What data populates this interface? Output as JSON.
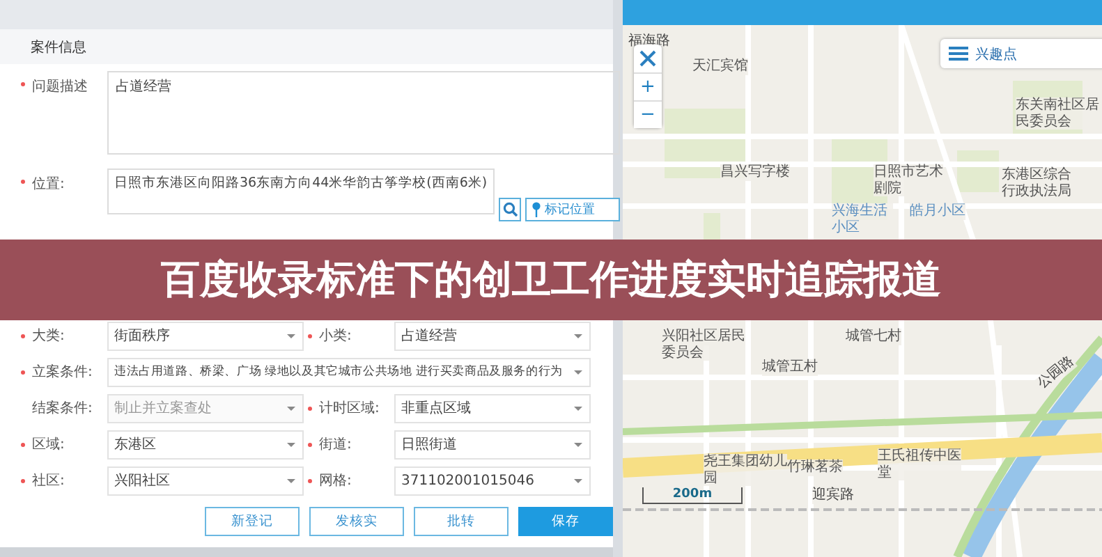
{
  "case_form": {
    "title": "案件信息",
    "description": {
      "label": "问题描述",
      "required": true,
      "value": "占道经营"
    },
    "location": {
      "label": "位置:",
      "required": true,
      "value": "日照市东港区向阳路36东南方向44米华韵古筝学校(西南6米)",
      "mark_button": "标记位置"
    },
    "rows": [
      [
        {
          "label": "大类:",
          "required": true,
          "value": "街面秩序",
          "disabled": false,
          "dropdown": true
        },
        {
          "label": "小类:",
          "required": true,
          "value": "占道经营",
          "disabled": false,
          "dropdown": true
        }
      ],
      [
        {
          "label": "立案条件:",
          "required": true,
          "value": "违法占用道路、桥梁、广场 绿地以及其它城市公共场地 进行买卖商品及服务的行为",
          "disabled": false,
          "dropdown": true
        }
      ],
      [
        {
          "label": "结案条件:",
          "required": false,
          "value": "制止并立案查处",
          "disabled": true,
          "dropdown": true
        },
        {
          "label": "计时区域:",
          "required": true,
          "value": "非重点区域",
          "disabled": false,
          "dropdown": true
        }
      ],
      [
        {
          "label": "区域:",
          "required": true,
          "value": "东港区",
          "disabled": false,
          "dropdown": true
        },
        {
          "label": "街道:",
          "required": true,
          "value": "日照街道",
          "disabled": false,
          "dropdown": true
        }
      ],
      [
        {
          "label": "社区:",
          "required": true,
          "value": "兴阳社区",
          "disabled": false,
          "dropdown": true
        },
        {
          "label": "网格:",
          "required": true,
          "value": "371102001015046",
          "disabled": false,
          "dropdown": true
        }
      ]
    ],
    "buttons": [
      {
        "label": "新登记",
        "primary": false
      },
      {
        "label": "发核实",
        "primary": false
      },
      {
        "label": "批转",
        "primary": false
      },
      {
        "label": "保存",
        "primary": true
      }
    ]
  },
  "map": {
    "zoom_in": "+",
    "zoom_out": "−",
    "poi_button": "兴趣点",
    "scale": "200m",
    "labels": [
      {
        "text": "福海路",
        "kind": "road"
      },
      {
        "text": "天汇宾馆",
        "kind": "place"
      },
      {
        "text": "东关南社区居民委员会",
        "kind": "place"
      },
      {
        "text": "昌兴写字楼",
        "kind": "place"
      },
      {
        "text": "日照市艺术剧院",
        "kind": "place"
      },
      {
        "text": "东港区综合行政执法局",
        "kind": "place"
      },
      {
        "text": "兴海生活小区",
        "kind": "area"
      },
      {
        "text": "皓月小区",
        "kind": "area"
      },
      {
        "text": "城管七村",
        "kind": "place"
      },
      {
        "text": "兴阳社区居民委员会",
        "kind": "place"
      },
      {
        "text": "城管五村",
        "kind": "place"
      },
      {
        "text": "尧王集团幼儿园",
        "kind": "place"
      },
      {
        "text": "竹琳茗茶",
        "kind": "place"
      },
      {
        "text": "王氏祖传中医堂",
        "kind": "place"
      },
      {
        "text": "迎宾路",
        "kind": "road"
      },
      {
        "text": "公园路",
        "kind": "road"
      }
    ]
  },
  "banner": {
    "text": "百度收录标准下的创卫工作进度实时追踪报道"
  }
}
